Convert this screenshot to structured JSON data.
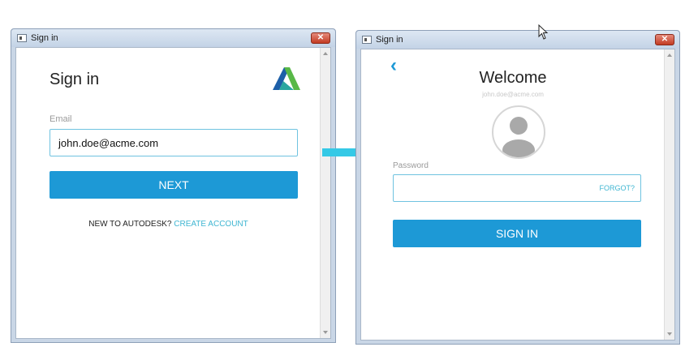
{
  "left_window": {
    "title": "Sign in",
    "close_glyph": "✕",
    "heading": "Sign in",
    "email_label": "Email",
    "email_value": "john.doe@acme.com",
    "next_label": "NEXT",
    "new_prefix": "NEW TO AUTODESK?",
    "create_account": "CREATE ACCOUNT",
    "logo_icon": "autodesk-logo"
  },
  "right_window": {
    "title": "Sign in",
    "close_glyph": "✕",
    "back_glyph": "‹",
    "heading": "Welcome",
    "email_sub": "john.doe@acme.com",
    "password_label": "Password",
    "password_value": "",
    "forgot_label": "FORGOT?",
    "sign_in_label": "SIGN IN",
    "avatar_icon": "user-avatar-icon"
  },
  "colors": {
    "accent": "#1d99d6",
    "link": "#3fb6d2",
    "arrow": "#35c9e6"
  }
}
